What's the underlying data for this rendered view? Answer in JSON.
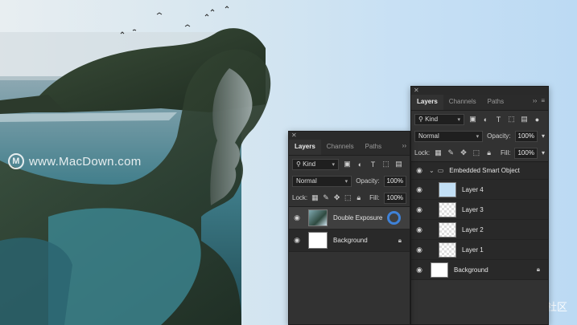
{
  "watermarks": {
    "left": "www.MacDown.com",
    "left_logo": "M",
    "right": "@稀土掘金技术社区"
  },
  "colors": {
    "panel_bg": "#323232",
    "selected_row": "#3f3f3f",
    "progress": "#3f82d8",
    "sky": "#c7e0f4"
  },
  "panel_front": {
    "tabs": [
      "Layers",
      "Channels",
      "Paths"
    ],
    "active_tab": "Layers",
    "filter_label": "Kind",
    "blend_mode": "Normal",
    "opacity_label": "Opacity:",
    "opacity_value": "100%",
    "lock_label": "Lock:",
    "fill_label": "Fill:",
    "fill_value": "100%",
    "layers": [
      {
        "name": "Double Exposure",
        "thumb": "photo-icon",
        "selected": true,
        "status": "processing-spinner-icon"
      },
      {
        "name": "Background",
        "thumb": "white",
        "selected": false,
        "status": "lock-icon"
      }
    ]
  },
  "panel_back": {
    "tabs": [
      "Layers",
      "Channels",
      "Paths"
    ],
    "active_tab": "Layers",
    "filter_label": "Kind",
    "blend_mode": "Normal",
    "opacity_label": "Opacity:",
    "opacity_value": "100%",
    "lock_label": "Lock:",
    "fill_label": "Fill:",
    "fill_value": "100%",
    "group_name": "Embedded Smart Object",
    "layers": [
      {
        "name": "Layer 4",
        "thumb": "blue"
      },
      {
        "name": "Layer 3",
        "thumb": "mask"
      },
      {
        "name": "Layer 2",
        "thumb": "mask"
      },
      {
        "name": "Layer 1",
        "thumb": "mask"
      },
      {
        "name": "Background",
        "thumb": "white",
        "status": "lock-icon"
      }
    ]
  }
}
